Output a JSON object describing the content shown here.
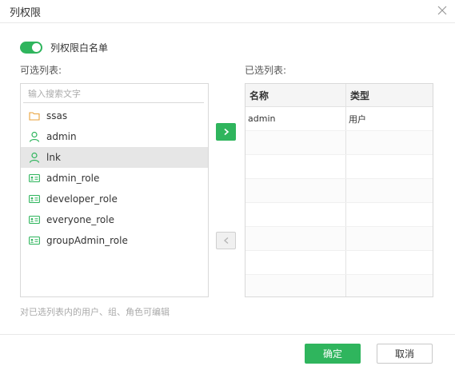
{
  "dialog": {
    "title": "列权限",
    "close_icon": "close-icon"
  },
  "whitelist": {
    "label": "列权限白名单",
    "enabled": true,
    "accent": "#2fb55d"
  },
  "available": {
    "label": "可选列表:",
    "search_placeholder": "输入搜索文字",
    "items": [
      {
        "label": "ssas",
        "icon": "folder-icon",
        "selected": false
      },
      {
        "label": "admin",
        "icon": "user-icon",
        "selected": false
      },
      {
        "label": "lnk",
        "icon": "user-icon",
        "selected": true
      },
      {
        "label": "admin_role",
        "icon": "role-card-icon",
        "selected": false
      },
      {
        "label": "developer_role",
        "icon": "role-card-icon",
        "selected": false
      },
      {
        "label": "everyone_role",
        "icon": "role-card-icon",
        "selected": false
      },
      {
        "label": "groupAdmin_role",
        "icon": "role-card-icon",
        "selected": false
      }
    ]
  },
  "selected": {
    "label": "已选列表:",
    "columns": [
      "名称",
      "类型"
    ],
    "rows": [
      [
        "admin",
        "用户"
      ]
    ]
  },
  "hint": "对已选列表内的用户、组、角色可编辑",
  "footer": {
    "ok_label": "确定",
    "cancel_label": "取消"
  }
}
